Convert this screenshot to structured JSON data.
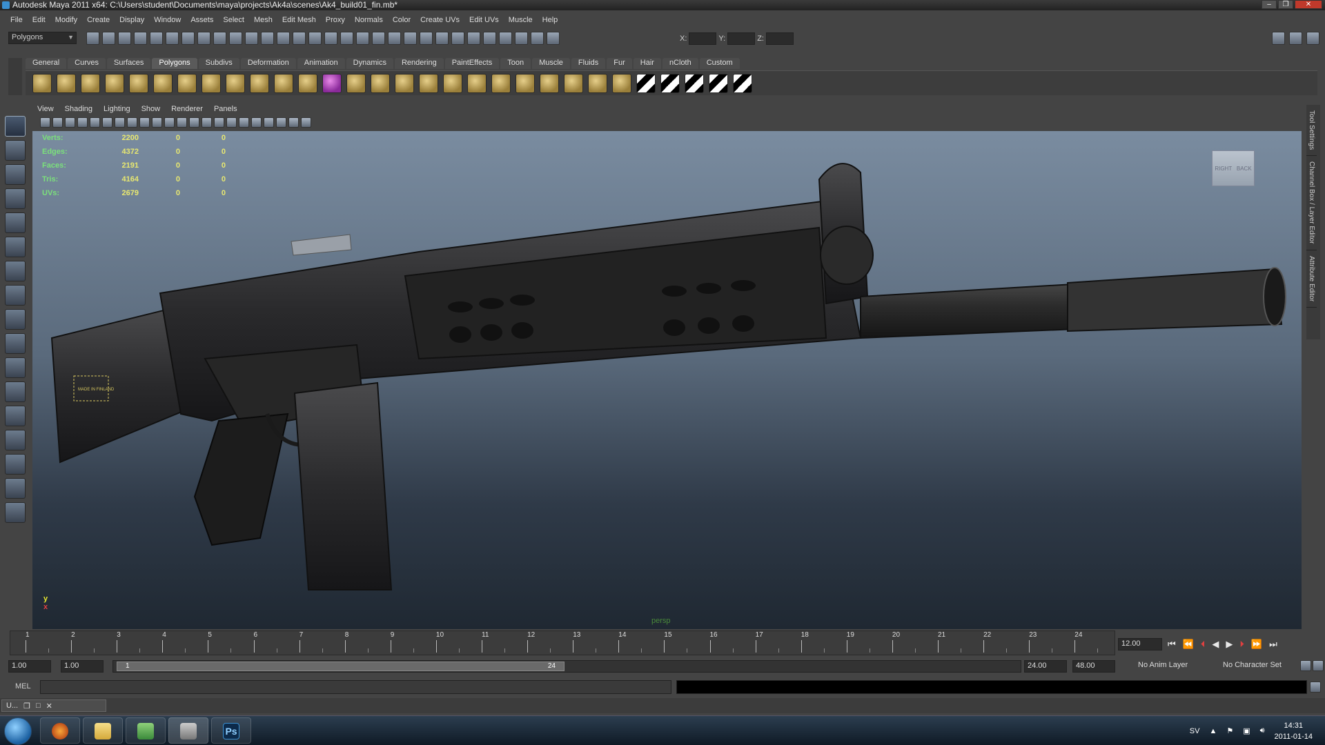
{
  "window": {
    "title": "Autodesk Maya 2011 x64: C:\\Users\\student\\Documents\\maya\\projects\\Ak4a\\scenes\\Ak4_build01_fin.mb*",
    "controls": [
      "–",
      "❐",
      "✕"
    ]
  },
  "menubar": [
    "File",
    "Edit",
    "Modify",
    "Create",
    "Display",
    "Window",
    "Assets",
    "Select",
    "Mesh",
    "Edit Mesh",
    "Proxy",
    "Normals",
    "Color",
    "Create UVs",
    "Edit UVs",
    "Muscle",
    "Help"
  ],
  "statusline": {
    "mode": "Polygons",
    "x_label": "X:",
    "y_label": "Y:",
    "z_label": "Z:"
  },
  "shelf": {
    "tabs": [
      "General",
      "Curves",
      "Surfaces",
      "Polygons",
      "Subdivs",
      "Deformation",
      "Animation",
      "Dynamics",
      "Rendering",
      "PaintEffects",
      "Toon",
      "Muscle",
      "Fluids",
      "Fur",
      "Hair",
      "nCloth",
      "Custom"
    ],
    "active_tab": "Polygons"
  },
  "panel_menu": [
    "View",
    "Shading",
    "Lighting",
    "Show",
    "Renderer",
    "Panels"
  ],
  "hud": {
    "rows": [
      {
        "label": "Verts:",
        "value": "2200",
        "v2": "0",
        "v3": "0"
      },
      {
        "label": "Edges:",
        "value": "4372",
        "v2": "0",
        "v3": "0"
      },
      {
        "label": "Faces:",
        "value": "2191",
        "v2": "0",
        "v3": "0"
      },
      {
        "label": "Tris:",
        "value": "4164",
        "v2": "0",
        "v3": "0"
      },
      {
        "label": "UVs:",
        "value": "2679",
        "v2": "0",
        "v3": "0"
      }
    ]
  },
  "viewport": {
    "camera_label": "persp",
    "viewcube_left": "RIGHT",
    "viewcube_right": "BACK",
    "axis_y": "y",
    "axis_x": "x",
    "gun_stamp": "MADE IN FINLAND"
  },
  "side_tabs": [
    "Tool Settings",
    "Channel Box / Layer Editor",
    "Attribute Editor"
  ],
  "timeslider": {
    "ticks": [
      "1",
      "2",
      "3",
      "4",
      "5",
      "6",
      "7",
      "8",
      "9",
      "10",
      "11",
      "12",
      "13",
      "14",
      "15",
      "16",
      "17",
      "18",
      "19",
      "20",
      "21",
      "22",
      "23",
      "24"
    ],
    "current_frame": "12.00",
    "playback_buttons": [
      "⏮",
      "⏪",
      "⏴",
      "◀",
      "▶",
      "⏵",
      "⏩",
      "⏭"
    ]
  },
  "range": {
    "start_outer": "1.00",
    "start_inner": "1.00",
    "handle_start": "1",
    "handle_end": "24",
    "end_inner": "24.00",
    "end_outer": "48.00",
    "anim_layer": "No Anim Layer",
    "character_set": "No Character Set"
  },
  "cmdline": {
    "label": "MEL"
  },
  "helpline": {
    "window_label": "U..."
  },
  "taskbar": {
    "language": "SV",
    "time": "14:31",
    "date": "2011-01-14",
    "apps": [
      "firefox",
      "explorer",
      "network",
      "maya",
      "photoshop"
    ],
    "ps_label": "Ps"
  }
}
